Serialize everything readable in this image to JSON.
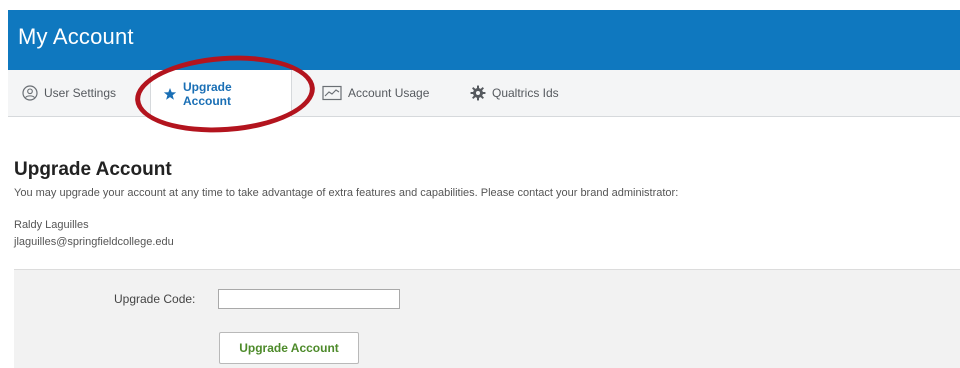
{
  "header": {
    "title": "My Account"
  },
  "tabs": [
    {
      "label": "User Settings",
      "icon": "user-circle-icon",
      "active": false
    },
    {
      "label": "Upgrade Account",
      "icon": "star-icon",
      "active": true
    },
    {
      "label": "Account Usage",
      "icon": "chart-icon",
      "active": false
    },
    {
      "label": "Qualtrics Ids",
      "icon": "gear-icon",
      "active": false
    }
  ],
  "main": {
    "heading": "Upgrade Account",
    "description": "You may upgrade your account at any time to take advantage of extra features and capabilities. Please contact your brand administrator:",
    "admin_name": "Raldy Laguilles",
    "admin_email": "jlaguilles@springfieldcollege.edu"
  },
  "form": {
    "code_label": "Upgrade Code:",
    "code_value": "",
    "submit_label": "Upgrade Account"
  },
  "colors": {
    "header_bg": "#0f78bf",
    "active_tab_text": "#1a6fb5",
    "highlight": "#b3141e",
    "submit_text": "#4d8a2a"
  }
}
